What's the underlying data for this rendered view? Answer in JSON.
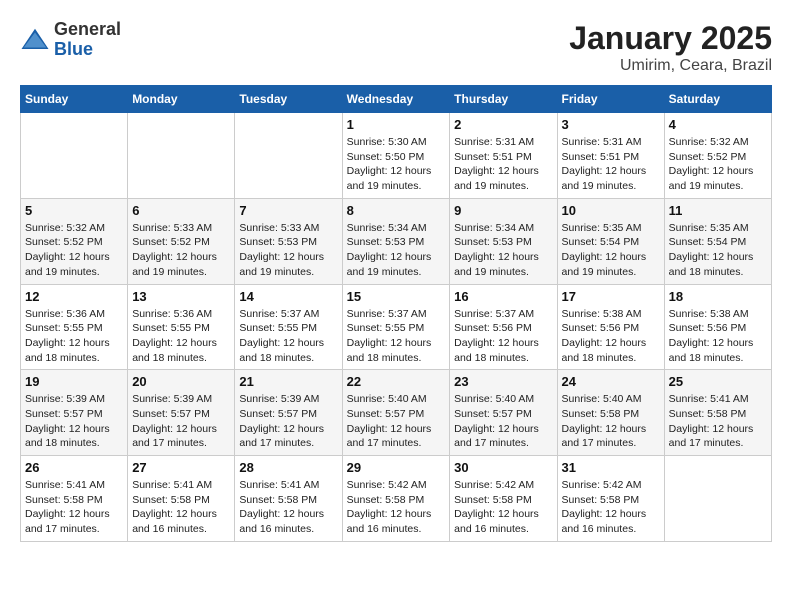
{
  "logo": {
    "general": "General",
    "blue": "Blue"
  },
  "title": "January 2025",
  "subtitle": "Umirim, Ceara, Brazil",
  "days_of_week": [
    "Sunday",
    "Monday",
    "Tuesday",
    "Wednesday",
    "Thursday",
    "Friday",
    "Saturday"
  ],
  "weeks": [
    [
      {
        "day": "",
        "info": ""
      },
      {
        "day": "",
        "info": ""
      },
      {
        "day": "",
        "info": ""
      },
      {
        "day": "1",
        "info": "Sunrise: 5:30 AM\nSunset: 5:50 PM\nDaylight: 12 hours\nand 19 minutes."
      },
      {
        "day": "2",
        "info": "Sunrise: 5:31 AM\nSunset: 5:51 PM\nDaylight: 12 hours\nand 19 minutes."
      },
      {
        "day": "3",
        "info": "Sunrise: 5:31 AM\nSunset: 5:51 PM\nDaylight: 12 hours\nand 19 minutes."
      },
      {
        "day": "4",
        "info": "Sunrise: 5:32 AM\nSunset: 5:52 PM\nDaylight: 12 hours\nand 19 minutes."
      }
    ],
    [
      {
        "day": "5",
        "info": "Sunrise: 5:32 AM\nSunset: 5:52 PM\nDaylight: 12 hours\nand 19 minutes."
      },
      {
        "day": "6",
        "info": "Sunrise: 5:33 AM\nSunset: 5:52 PM\nDaylight: 12 hours\nand 19 minutes."
      },
      {
        "day": "7",
        "info": "Sunrise: 5:33 AM\nSunset: 5:53 PM\nDaylight: 12 hours\nand 19 minutes."
      },
      {
        "day": "8",
        "info": "Sunrise: 5:34 AM\nSunset: 5:53 PM\nDaylight: 12 hours\nand 19 minutes."
      },
      {
        "day": "9",
        "info": "Sunrise: 5:34 AM\nSunset: 5:53 PM\nDaylight: 12 hours\nand 19 minutes."
      },
      {
        "day": "10",
        "info": "Sunrise: 5:35 AM\nSunset: 5:54 PM\nDaylight: 12 hours\nand 19 minutes."
      },
      {
        "day": "11",
        "info": "Sunrise: 5:35 AM\nSunset: 5:54 PM\nDaylight: 12 hours\nand 18 minutes."
      }
    ],
    [
      {
        "day": "12",
        "info": "Sunrise: 5:36 AM\nSunset: 5:55 PM\nDaylight: 12 hours\nand 18 minutes."
      },
      {
        "day": "13",
        "info": "Sunrise: 5:36 AM\nSunset: 5:55 PM\nDaylight: 12 hours\nand 18 minutes."
      },
      {
        "day": "14",
        "info": "Sunrise: 5:37 AM\nSunset: 5:55 PM\nDaylight: 12 hours\nand 18 minutes."
      },
      {
        "day": "15",
        "info": "Sunrise: 5:37 AM\nSunset: 5:55 PM\nDaylight: 12 hours\nand 18 minutes."
      },
      {
        "day": "16",
        "info": "Sunrise: 5:37 AM\nSunset: 5:56 PM\nDaylight: 12 hours\nand 18 minutes."
      },
      {
        "day": "17",
        "info": "Sunrise: 5:38 AM\nSunset: 5:56 PM\nDaylight: 12 hours\nand 18 minutes."
      },
      {
        "day": "18",
        "info": "Sunrise: 5:38 AM\nSunset: 5:56 PM\nDaylight: 12 hours\nand 18 minutes."
      }
    ],
    [
      {
        "day": "19",
        "info": "Sunrise: 5:39 AM\nSunset: 5:57 PM\nDaylight: 12 hours\nand 18 minutes."
      },
      {
        "day": "20",
        "info": "Sunrise: 5:39 AM\nSunset: 5:57 PM\nDaylight: 12 hours\nand 17 minutes."
      },
      {
        "day": "21",
        "info": "Sunrise: 5:39 AM\nSunset: 5:57 PM\nDaylight: 12 hours\nand 17 minutes."
      },
      {
        "day": "22",
        "info": "Sunrise: 5:40 AM\nSunset: 5:57 PM\nDaylight: 12 hours\nand 17 minutes."
      },
      {
        "day": "23",
        "info": "Sunrise: 5:40 AM\nSunset: 5:57 PM\nDaylight: 12 hours\nand 17 minutes."
      },
      {
        "day": "24",
        "info": "Sunrise: 5:40 AM\nSunset: 5:58 PM\nDaylight: 12 hours\nand 17 minutes."
      },
      {
        "day": "25",
        "info": "Sunrise: 5:41 AM\nSunset: 5:58 PM\nDaylight: 12 hours\nand 17 minutes."
      }
    ],
    [
      {
        "day": "26",
        "info": "Sunrise: 5:41 AM\nSunset: 5:58 PM\nDaylight: 12 hours\nand 17 minutes."
      },
      {
        "day": "27",
        "info": "Sunrise: 5:41 AM\nSunset: 5:58 PM\nDaylight: 12 hours\nand 16 minutes."
      },
      {
        "day": "28",
        "info": "Sunrise: 5:41 AM\nSunset: 5:58 PM\nDaylight: 12 hours\nand 16 minutes."
      },
      {
        "day": "29",
        "info": "Sunrise: 5:42 AM\nSunset: 5:58 PM\nDaylight: 12 hours\nand 16 minutes."
      },
      {
        "day": "30",
        "info": "Sunrise: 5:42 AM\nSunset: 5:58 PM\nDaylight: 12 hours\nand 16 minutes."
      },
      {
        "day": "31",
        "info": "Sunrise: 5:42 AM\nSunset: 5:58 PM\nDaylight: 12 hours\nand 16 minutes."
      },
      {
        "day": "",
        "info": ""
      }
    ]
  ]
}
